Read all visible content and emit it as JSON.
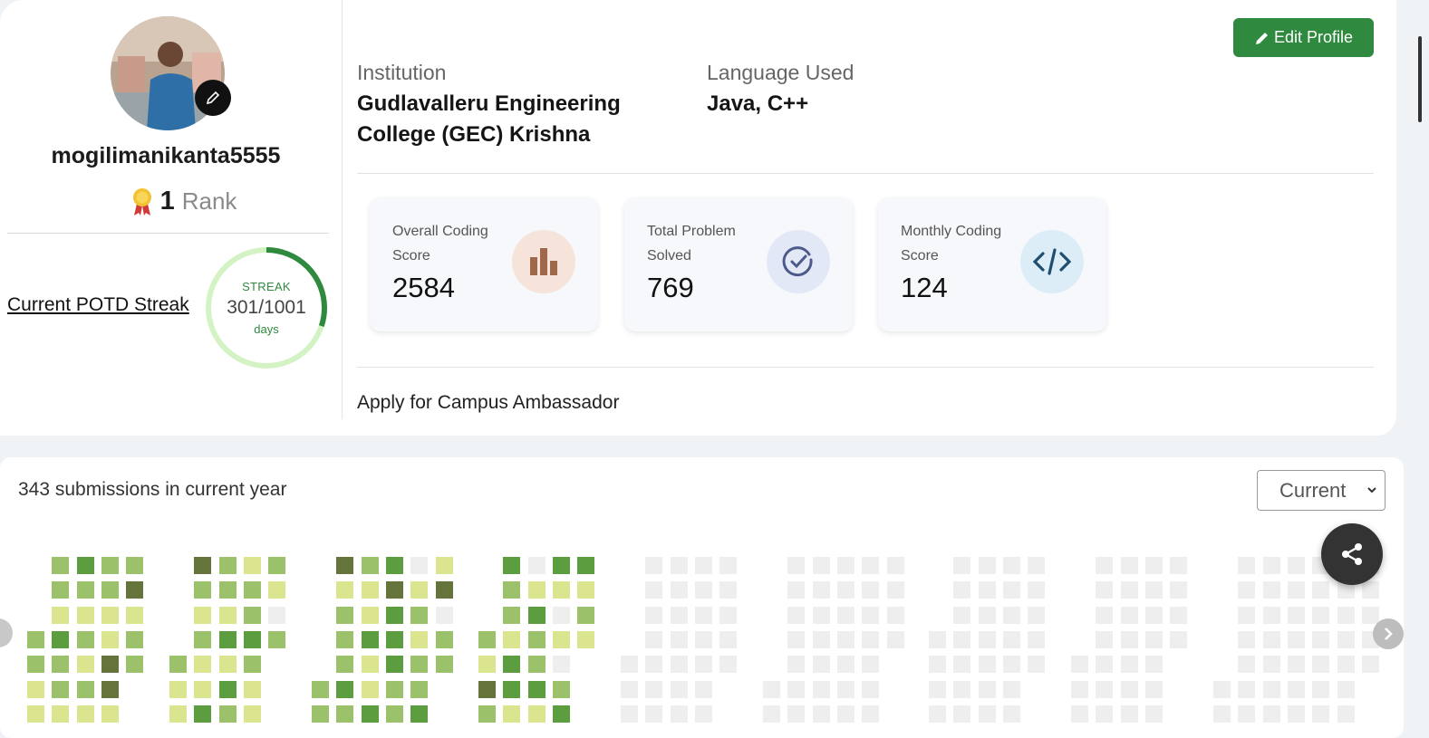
{
  "profile": {
    "username": "mogilimanikanta5555",
    "rank_value": "1",
    "rank_label": "Rank",
    "potd_link": "Current POTD Streak",
    "streak": {
      "title": "STREAK",
      "count": "301/1001",
      "unit": "days",
      "progress": 0.3007
    }
  },
  "edit_profile_label": "Edit Profile",
  "institution": {
    "label": "Institution",
    "value": "Gudlavalleru Engineering College (GEC) Krishna"
  },
  "language": {
    "label": "Language Used",
    "value": "Java, C++"
  },
  "stats": [
    {
      "label": "Overall Coding Score",
      "value": "2584",
      "icon": "bar-chart-icon",
      "color": "#a0684a",
      "bg": "#f6e3d9"
    },
    {
      "label": "Total Problem Solved",
      "value": "769",
      "icon": "check-circle-icon",
      "color": "#4a5a8a",
      "bg": "#e3e8f6"
    },
    {
      "label": "Monthly Coding Score",
      "value": "124",
      "icon": "code-icon",
      "color": "#1f4e70",
      "bg": "#dcedf7"
    }
  ],
  "campus_ambassador": "Apply for Campus Ambassador",
  "submissions": {
    "title": "343 submissions in current year",
    "year_selected": "Current"
  },
  "colors": {
    "brand_green": "#2f8a3f",
    "heat_levels": [
      "#eeeeee",
      "#dbe48f",
      "#9bc16a",
      "#5c9e3f",
      "#64743a"
    ]
  }
}
